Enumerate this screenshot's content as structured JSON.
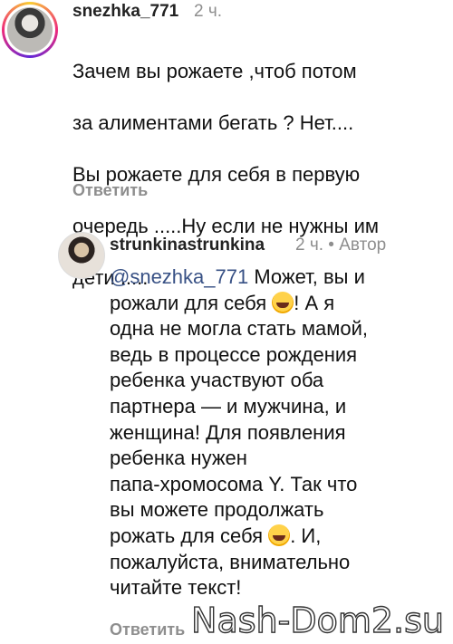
{
  "comments": [
    {
      "username": "snezhka_771",
      "time": "2 ч.",
      "lines": [
        "Зачем вы рожаете ,чтоб потом",
        "за алиментами бегать ? Нет....",
        "Вы рожаете для себя в первую",
        "очередь .....Ну если не нужны им",
        "дети ....."
      ],
      "reply_label": "Ответить"
    },
    {
      "username": "strunkinastrunkina",
      "time": "2 ч. • Автор",
      "mention": "@snezhka_771",
      "line1_rest": " Может, вы и",
      "line2_start": "рожали для себя ",
      "line2_end": "! А я",
      "lines_mid": [
        "одна не могла стать мамой,",
        "ведь в процессе рождения",
        "ребенка участвуют оба",
        "партнера — и мужчина, и",
        "женщина! Для появления",
        "ребенка нужен",
        "папа-хромосома Y. Так что",
        "вы можете продолжать"
      ],
      "line11_start": "рожать для себя ",
      "line11_end": ". И,",
      "line12": "пожалуйста, внимательно",
      "line13": "читайте текст!",
      "reply_label": "Ответить",
      "emoji_name": "tears-of-joy-emoji"
    }
  ],
  "watermark": "Nash-Dom2.su",
  "colors": {
    "username": "#222222",
    "meta": "#8e8e8e",
    "mention": "#385185"
  }
}
